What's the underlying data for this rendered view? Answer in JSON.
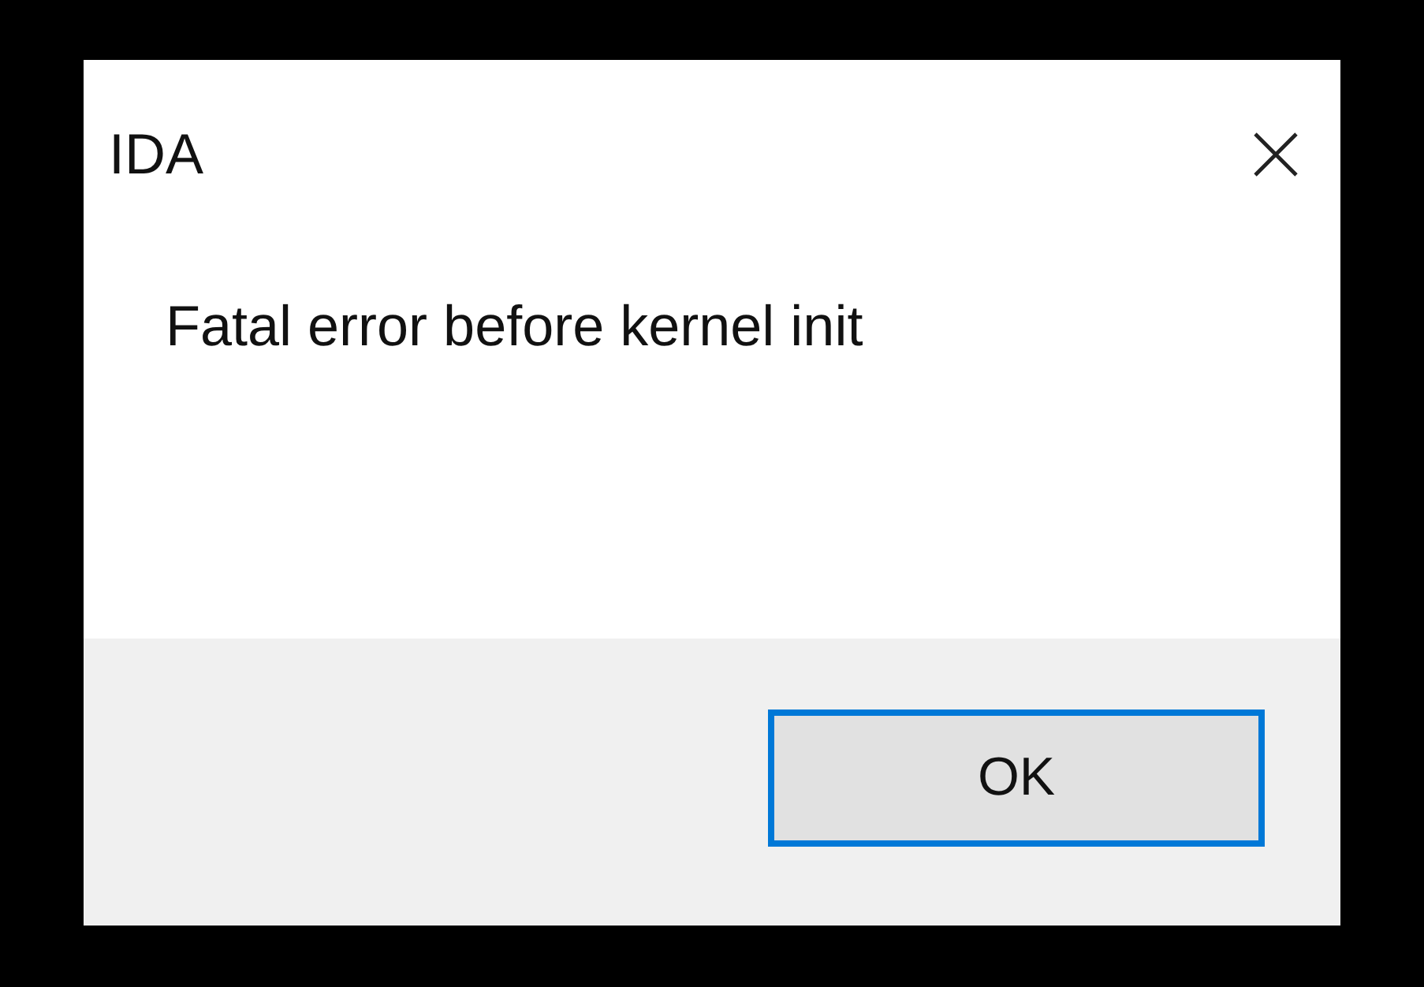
{
  "window": {
    "title": "IDA"
  },
  "message": "Fatal error before kernel init",
  "buttons": [
    {
      "label": "OK",
      "focused": true
    }
  ]
}
